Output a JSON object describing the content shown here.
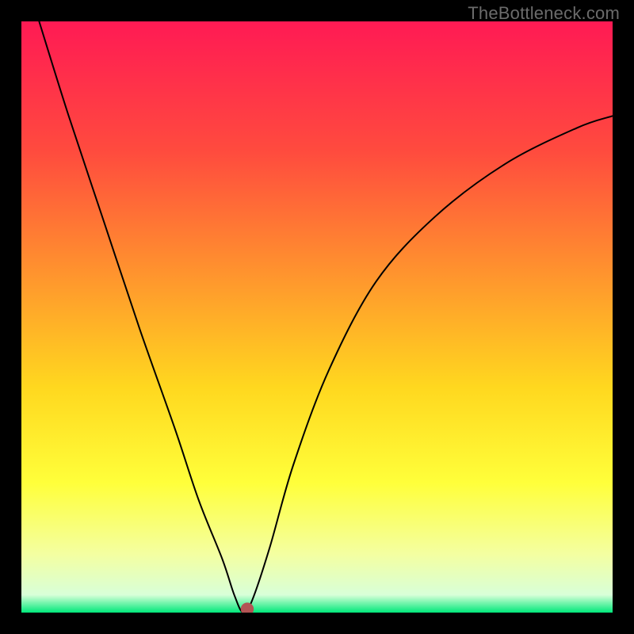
{
  "watermark": "TheBottleneck.com",
  "chart_data": {
    "type": "line",
    "title": "",
    "xlabel": "",
    "ylabel": "",
    "xlim": [
      0,
      100
    ],
    "ylim": [
      0,
      100
    ],
    "grid": false,
    "gradient_stops": [
      {
        "offset": 0,
        "color": "#ff1a54"
      },
      {
        "offset": 0.22,
        "color": "#ff4b3e"
      },
      {
        "offset": 0.45,
        "color": "#ff9c2c"
      },
      {
        "offset": 0.62,
        "color": "#ffd81f"
      },
      {
        "offset": 0.78,
        "color": "#ffff3a"
      },
      {
        "offset": 0.9,
        "color": "#f4ffa0"
      },
      {
        "offset": 0.97,
        "color": "#d8ffd8"
      },
      {
        "offset": 1.0,
        "color": "#00e87a"
      }
    ],
    "curve": {
      "x": [
        3,
        8,
        14,
        20,
        26,
        30,
        34,
        36,
        37.5,
        39,
        42,
        46,
        52,
        60,
        70,
        82,
        94,
        100
      ],
      "y": [
        100,
        84,
        66,
        48,
        31,
        19,
        9,
        3,
        0,
        2,
        11,
        25,
        41,
        56,
        67,
        76,
        82,
        84
      ]
    },
    "marker": {
      "x": 38.2,
      "y": 0.6,
      "color": "#b25454",
      "r": 1.1
    }
  }
}
